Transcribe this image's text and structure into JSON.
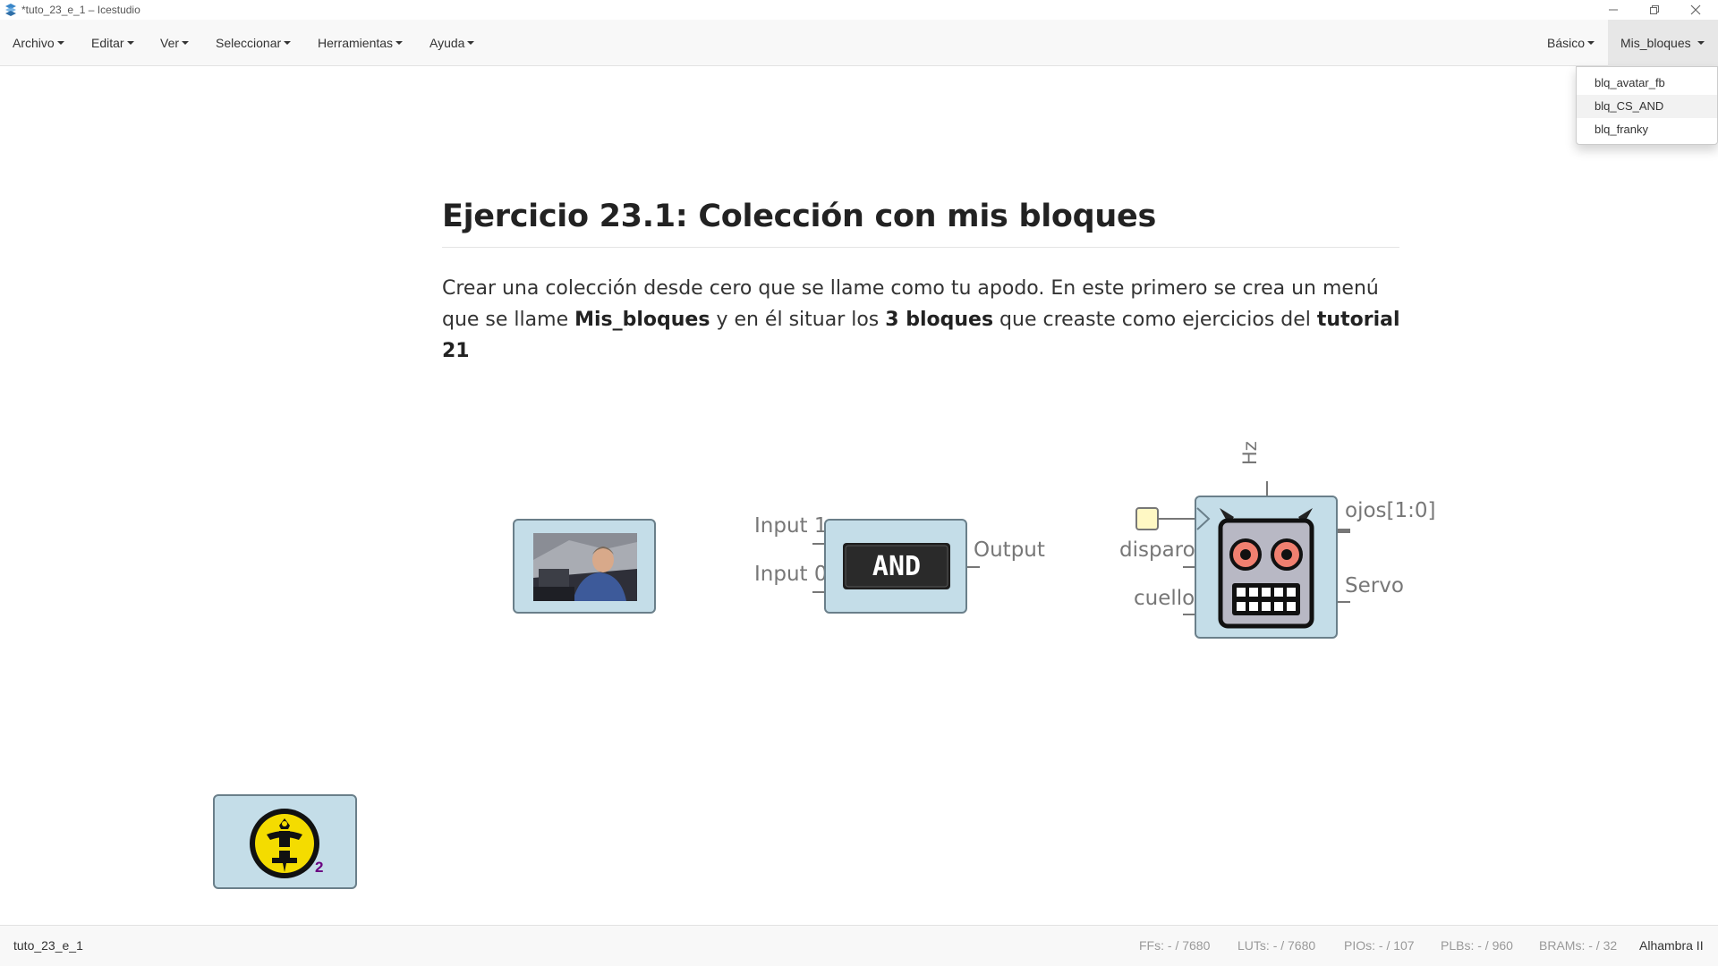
{
  "window": {
    "title": "*tuto_23_e_1 – Icestudio",
    "controls": [
      "minimize",
      "restore",
      "close"
    ]
  },
  "menubar": {
    "left": [
      "Archivo",
      "Editar",
      "Ver",
      "Seleccionar",
      "Herramientas",
      "Ayuda"
    ],
    "right": [
      "Básico",
      "Mis_bloques"
    ]
  },
  "dropdown": {
    "open_menu": "Mis_bloques",
    "items": [
      "blq_avatar_fb",
      "blq_CS_AND",
      "blq_franky"
    ],
    "hovered": "blq_CS_AND"
  },
  "note": {
    "title": "Ejercicio 23.1: Colección con mis bloques",
    "p1": "Crear una colección desde cero que se llame como tu apodo. En este primero se crea un menú que se llame ",
    "b1": "Mis_bloques",
    "p2": " y en él situar los ",
    "b2": "3 bloques",
    "p3": " que creaste como ejercicios del ",
    "b3": "tutorial 21"
  },
  "blocks": {
    "and_block": {
      "inputs": [
        "Input 1",
        "Input 0"
      ],
      "output": "Output",
      "label": "AND"
    },
    "franky_block": {
      "param": "Hz",
      "inputs": [
        "disparo",
        "cuello"
      ],
      "outputs": [
        "ojos[1:0]",
        "Servo"
      ]
    },
    "logo_block": {
      "badge": "2"
    }
  },
  "statusbar": {
    "project": "tuto_23_e_1",
    "ffs": "FFs:",
    "ffs_val": "- / 7680",
    "luts": "LUTs:",
    "luts_val": "- / 7680",
    "pios": "PIOs:",
    "pios_val": "- / 107",
    "plbs": "PLBs:",
    "plbs_val": "- / 960",
    "brams": "BRAMs:",
    "brams_val": "- / 32",
    "board": "Alhambra II"
  },
  "colors": {
    "block_fill": "#c4dde8",
    "block_border": "#6a7f8a",
    "robot_eyes": "#f08070",
    "robot_face": "#b8b8c4",
    "logo_yellow": "#f4dc00",
    "badge": "#6a0080"
  }
}
